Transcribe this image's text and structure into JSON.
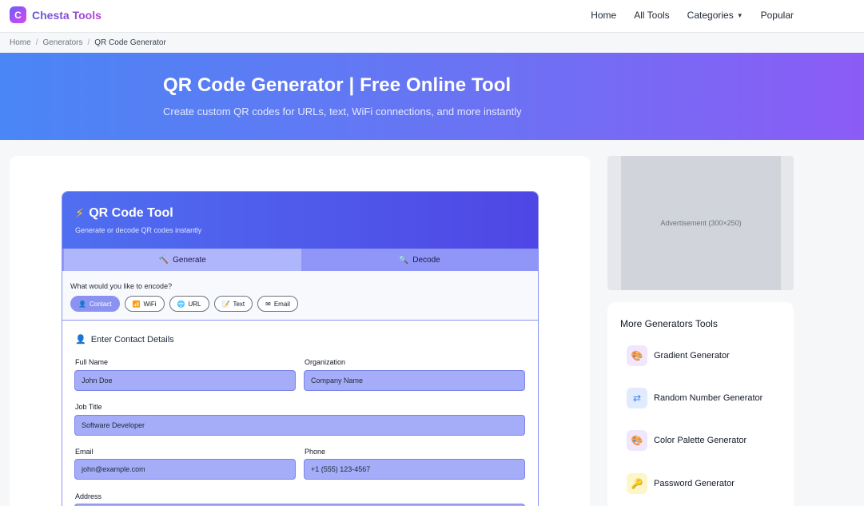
{
  "brand": {
    "logo_letter": "C",
    "name": "Chesta Tools"
  },
  "nav": {
    "home": "Home",
    "all_tools": "All Tools",
    "categories": "Categories",
    "popular": "Popular"
  },
  "breadcrumb": {
    "home": "Home",
    "generators": "Generators",
    "current": "QR Code Generator"
  },
  "hero": {
    "title": "QR Code Generator | Free Online Tool",
    "subtitle": "Create custom QR codes for URLs, text, WiFi connections, and more instantly"
  },
  "tool": {
    "title": "QR Code Tool",
    "subtitle": "Generate or decode QR codes instantly",
    "tabs": {
      "generate": "Generate",
      "decode": "Decode"
    },
    "encode_question": "What would you like to encode?",
    "chips": {
      "contact": "Contact",
      "wifi": "WiFi",
      "url": "URL",
      "text": "Text",
      "email": "Email"
    },
    "section_title": "Enter Contact Details",
    "labels": {
      "full_name": "Full Name",
      "organization": "Organization",
      "job_title": "Job Title",
      "email": "Email",
      "phone": "Phone",
      "address": "Address"
    },
    "values": {
      "full_name": "John Doe",
      "organization": "Company Name",
      "job_title": "Software Developer",
      "email": "john@example.com",
      "phone": "+1 (555) 123-4567"
    }
  },
  "ad": {
    "text": "Advertisement (300×250)"
  },
  "more_tools": {
    "title": "More Generators Tools",
    "items": {
      "gradient": "Gradient Generator",
      "random": "Random Number Generator",
      "palette": "Color Palette Generator",
      "password": "Password Generator"
    }
  },
  "colors": {
    "accent": "#8b93f2",
    "hero_start": "#4a86f5",
    "hero_end": "#8b5cf6"
  }
}
